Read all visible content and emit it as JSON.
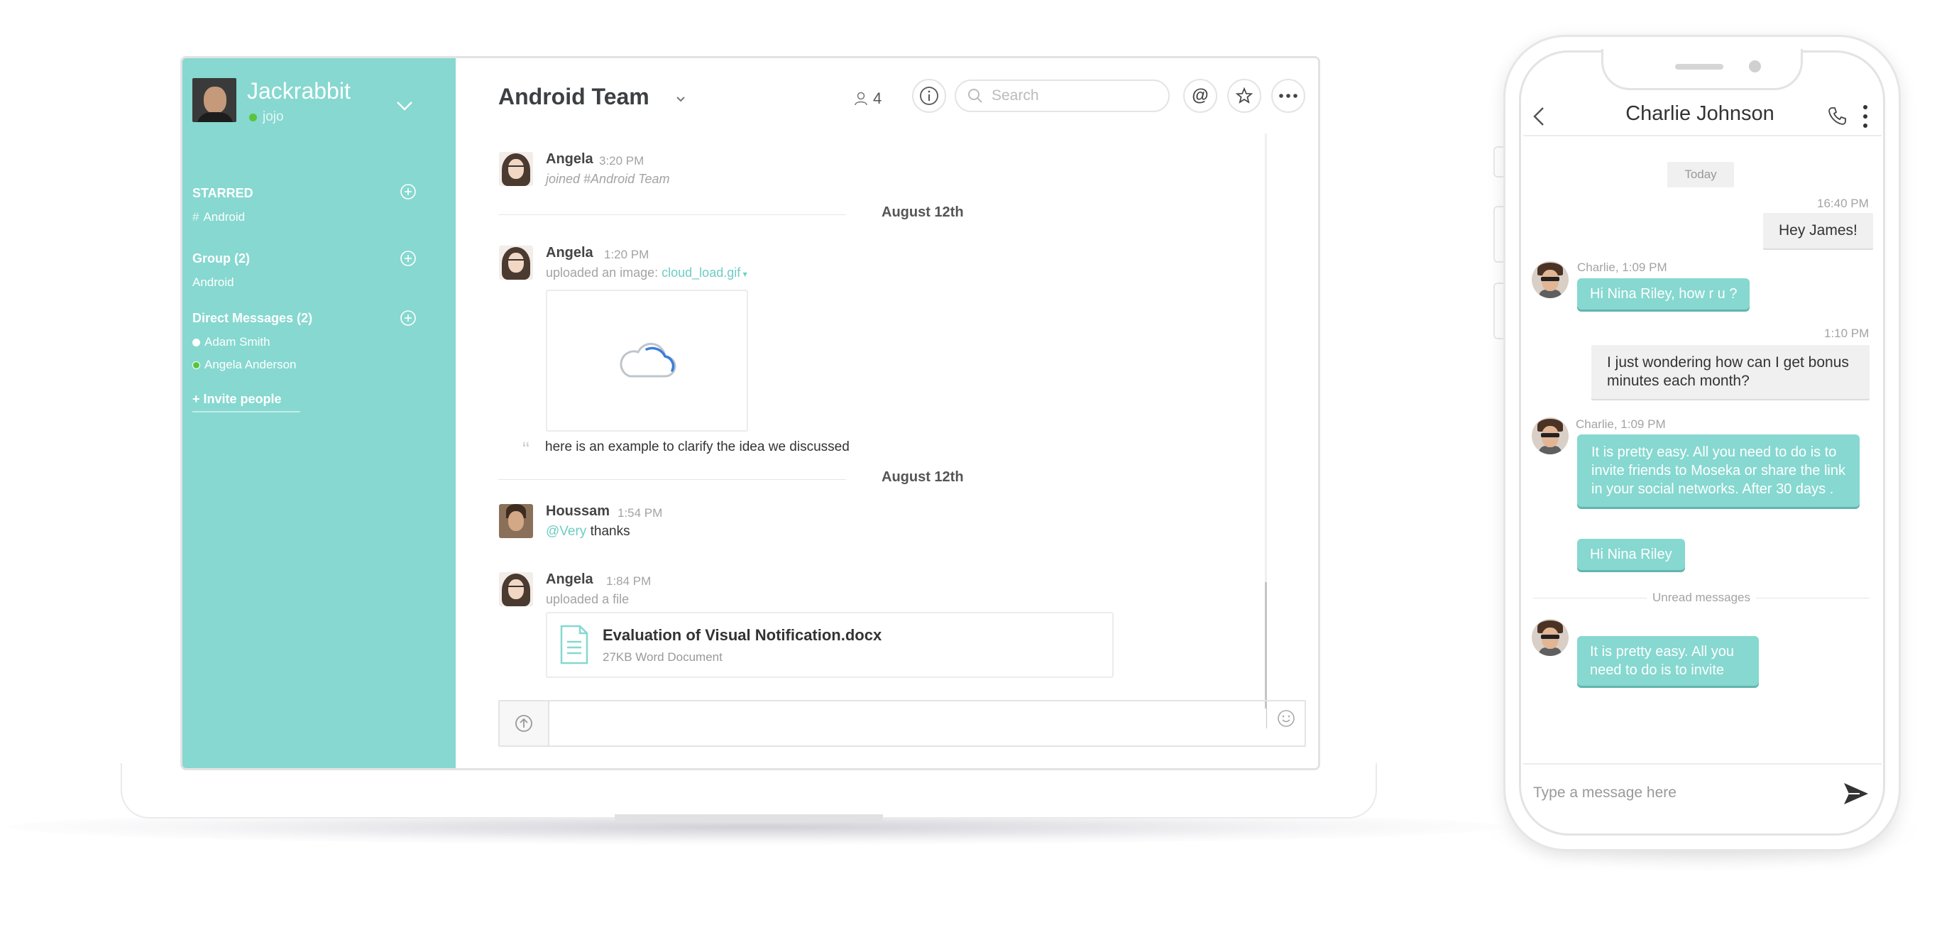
{
  "desktop": {
    "sidebar": {
      "team_name": "Jackrabbit",
      "username": "jojo",
      "sections": [
        {
          "title": "STARRED",
          "items": [
            {
              "prefix": "#",
              "label": "Android"
            }
          ]
        },
        {
          "title": "Group (2)",
          "items": [
            {
              "label": "Android"
            }
          ]
        },
        {
          "title": "Direct Messages (2)",
          "items": [
            {
              "label": "Adam Smith",
              "status": "white"
            },
            {
              "label": "Angela Anderson",
              "status": "green"
            }
          ]
        }
      ],
      "invite_label": "+ Invite people"
    },
    "header": {
      "channel_title": "Android Team",
      "member_count": "4",
      "search_placeholder": "Search"
    },
    "messages": [
      {
        "author": "Angela",
        "time": "3:20 PM",
        "meta": "joined #Android Team"
      },
      {
        "date_divider": "August 12th"
      },
      {
        "author": "Angela",
        "time": "1:20 PM",
        "meta_prefix": "uploaded an image:",
        "meta_link": "cloud_load.gif",
        "caption": "here is an example to clarify the idea we discussed"
      },
      {
        "date_divider": "August 12th"
      },
      {
        "author": "Houssam",
        "time": "1:54 PM",
        "mention": "@Very",
        "text": "thanks"
      },
      {
        "author": "Angela",
        "time": "1:84 PM",
        "meta": "uploaded a file",
        "file": {
          "name": "Evaluation of Visual Notification.docx",
          "size": "27KB Word Document"
        }
      }
    ],
    "composer": {
      "placeholder": ""
    }
  },
  "phone": {
    "contact_name": "Charlie Johnson",
    "day_label": "Today",
    "messages": [
      {
        "dir": "out",
        "time": "16:40 PM",
        "text": "Hey James!"
      },
      {
        "dir": "in",
        "meta": "Charlie, 1:09 PM",
        "texts": [
          "Hi Nina Riley, how r u ?"
        ]
      },
      {
        "dir": "out",
        "time": "1:10 PM",
        "text": "I just wondering how can I get bonus minutes each month?"
      },
      {
        "dir": "in",
        "meta": "Charlie, 1:09 PM",
        "texts": [
          "It is pretty easy. All you need to do is to invite friends to Moseka or share the link in your social networks. After 30 days .",
          "Hi Nina Riley"
        ]
      },
      {
        "dir": "in",
        "texts": [
          "It is pretty easy. All you need to do is to invite"
        ]
      }
    ],
    "unread_label": "Unread messages",
    "input_placeholder": "Type a message here"
  },
  "colors": {
    "accent": "#86d8d0",
    "link": "#6dcdc3",
    "online": "#59c33c"
  },
  "icons": [
    "chevron-down-icon",
    "add-circle-icon",
    "user-icon",
    "info-icon",
    "search-icon",
    "at-icon",
    "star-icon",
    "more-icon",
    "cloud-icon",
    "quote-icon",
    "document-icon",
    "upload-icon",
    "emoji-icon",
    "back-icon",
    "phone-icon",
    "more-vertical-icon",
    "send-icon"
  ]
}
